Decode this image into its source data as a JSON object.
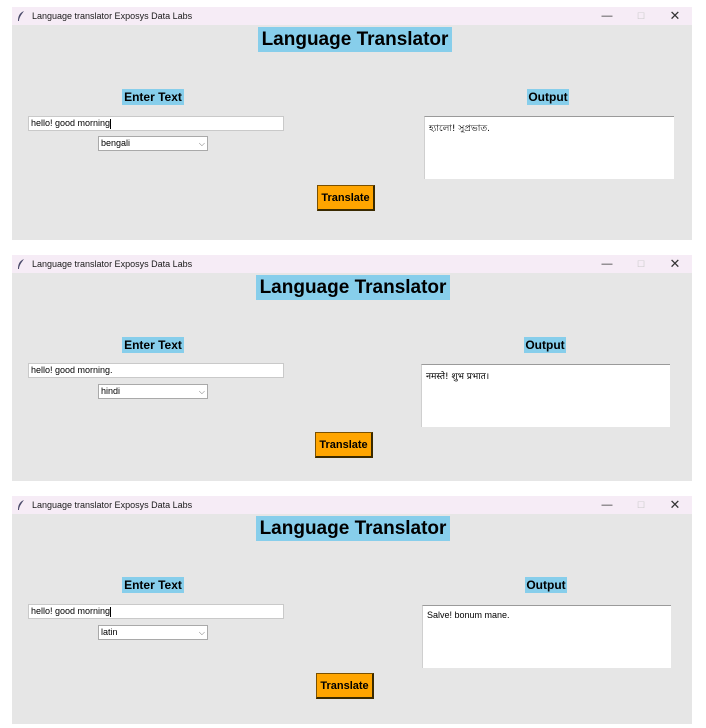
{
  "screens": [
    {
      "window_title": "Language translator Exposys Data Labs",
      "heading": "Language Translator",
      "enter_label": "Enter Text",
      "output_label": "Output",
      "input_value": "hello! good morning",
      "language": "bengali",
      "output_text": "হ্যালো! সুপ্রভাত.",
      "button_label": "Translate"
    },
    {
      "window_title": "Language translator Exposys Data Labs",
      "heading": "Language Translator",
      "enter_label": "Enter Text",
      "output_label": "Output",
      "input_value": "hello! good morning.",
      "language": "hindi",
      "output_text": "नमस्ते! शुभ प्रभात।",
      "button_label": "Translate"
    },
    {
      "window_title": "Language translator Exposys Data Labs",
      "heading": "Language Translator",
      "enter_label": "Enter Text",
      "output_label": "Output",
      "input_value": "hello! good morning",
      "language": "latin",
      "output_text": "Salve! bonum mane.",
      "button_label": "Translate"
    }
  ],
  "controls": {
    "minimize": "—",
    "maximize": "☐",
    "close": "✕",
    "dropdown": "⌵"
  },
  "colors": {
    "window_bg": "#e6e6e6",
    "titlebar_bg": "#f6ecf6",
    "label_bg": "#87ceeb",
    "button_bg": "#ffa500"
  },
  "icons": [
    "feather-icon",
    "minimize-icon",
    "maximize-icon",
    "close-icon",
    "chevron-down-icon"
  ]
}
